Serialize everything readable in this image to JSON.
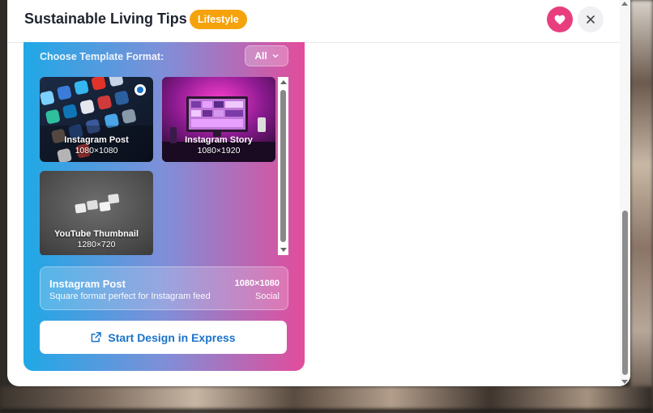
{
  "header": {
    "title": "Sustainable Living Tips",
    "badge": "Lifestyle",
    "heart_icon": "heart-icon",
    "close_icon": "close-icon"
  },
  "panel": {
    "choose_label": "Choose Template Format:",
    "filter": {
      "selected": "All"
    },
    "templates": [
      {
        "name": "Instagram Post",
        "size": "1080×1080",
        "selected": true
      },
      {
        "name": "Instagram Story",
        "size": "1080×1920",
        "selected": false
      },
      {
        "name": "YouTube Thumbnail",
        "size": "1280×720",
        "selected": false
      }
    ],
    "info": {
      "name": "Instagram Post",
      "description": "Square format perfect for Instagram feed",
      "size": "1080×1080",
      "category": "Social"
    },
    "start_button": "Start Design in Express"
  },
  "colors": {
    "badge": "#f5a20b",
    "heart_button": "#e83e7e",
    "gradient_start": "#1fa8e6",
    "gradient_end": "#e24c9b",
    "start_button_text": "#1a73c9"
  }
}
